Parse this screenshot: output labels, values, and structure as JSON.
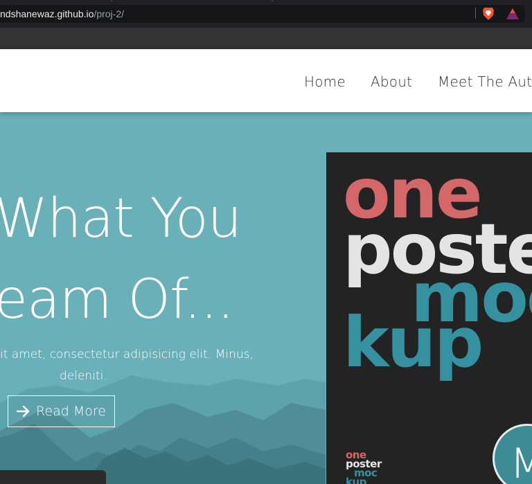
{
  "browser": {
    "url_host": "ndshanewaz.github.io",
    "url_path": "/proj-2/",
    "icons": [
      "brave-shield-icon",
      "brave-rewards-icon"
    ]
  },
  "nav": {
    "links": [
      "Home",
      "About",
      "Meet The Auth"
    ]
  },
  "hero": {
    "title_line1": "What You",
    "title_line2": "eam Of...",
    "text_line1": "it amet, consectetur adipisicing elit. Minus,",
    "text_line2": "deleniti.",
    "button_label": "Read More",
    "button_icon": "arrow-right-icon"
  },
  "poster": {
    "word_one": "one",
    "word_poster": "poste",
    "word_moc": "moc",
    "word_kup": "kup",
    "small_one": "one",
    "small_poster": "poster",
    "small_moc": "moc",
    "small_kup": "kup",
    "badge_letter": "M"
  },
  "colors": {
    "hero_bg": "#6ab0b8",
    "poster_bg": "#232323",
    "poster_red": "#d4676a",
    "poster_white": "#e4e4e4",
    "poster_teal": "#3591a0"
  }
}
